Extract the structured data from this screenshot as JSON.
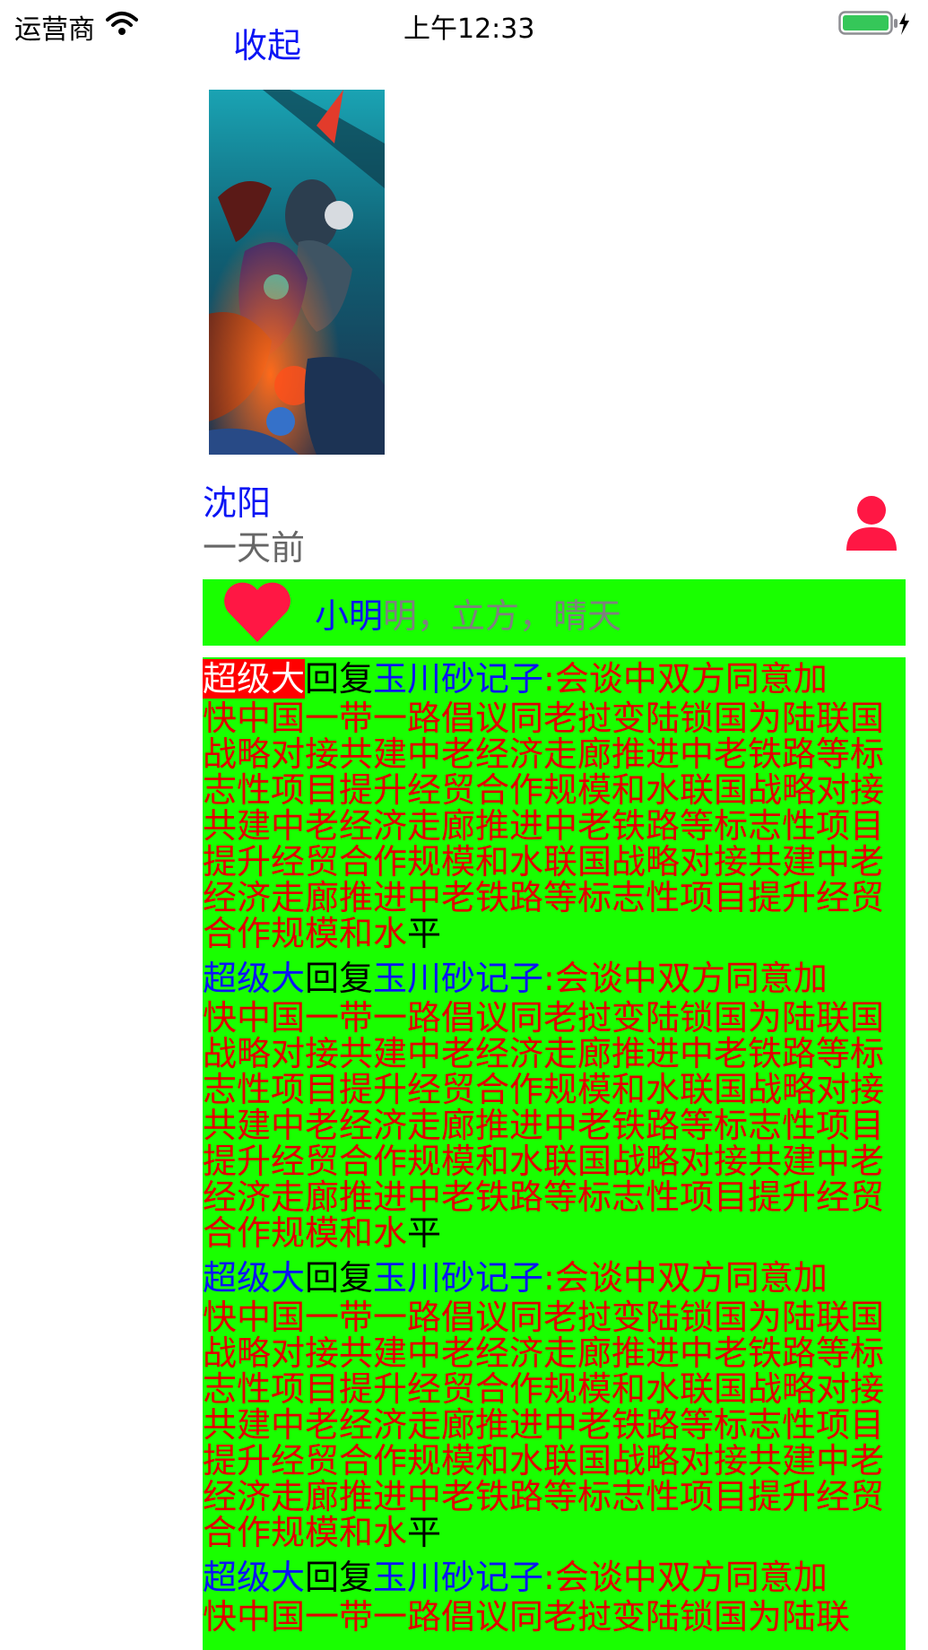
{
  "status_bar": {
    "carrier": "运营商",
    "time": "上午12:33",
    "wifi_icon": "wifi-icon",
    "battery_icon": "battery-charging-icon",
    "battery_color": "#35c759"
  },
  "header": {
    "collapse_label": "收起"
  },
  "post": {
    "image": "fantasy-game-artwork",
    "username": "沈阳",
    "time": "一天前",
    "avatar_icon": "user-icon",
    "avatar_color": "#ff1744"
  },
  "likes": {
    "heart_icon": "heart-icon",
    "first": "小明",
    "rest": "明，立方，晴天",
    "bar_color": "#19ff00"
  },
  "comments": [
    {
      "from": "超级大",
      "reply": "回复",
      "to": "玉川砂记子",
      "lead": ":会谈中双方同意加",
      "body": "快中国一带一路倡议同老挝变陆锁国为陆联国战略对接共建中老经济走廊推进中老铁路等标志性项目提升经贸合作规模和水联国战略对接共建中老经济走廊推进中老铁路等标志性项目提升经贸合作规模和水联国战略对接共建中老经济走廊推进中老铁路等标志性项目提升经贸合作规模和水",
      "tail": "平"
    },
    {
      "from": "超级大",
      "reply": "回复",
      "to": "玉川砂记子",
      "lead": ":会谈中双方同意加",
      "body": "快中国一带一路倡议同老挝变陆锁国为陆联国战略对接共建中老经济走廊推进中老铁路等标志性项目提升经贸合作规模和水联国战略对接共建中老经济走廊推进中老铁路等标志性项目提升经贸合作规模和水联国战略对接共建中老经济走廊推进中老铁路等标志性项目提升经贸合作规模和水",
      "tail": "平"
    },
    {
      "from": "超级大",
      "reply": "回复",
      "to": "玉川砂记子",
      "lead": ":会谈中双方同意加",
      "body": "快中国一带一路倡议同老挝变陆锁国为陆联国战略对接共建中老经济走廊推进中老铁路等标志性项目提升经贸合作规模和水联国战略对接共建中老经济走廊推进中老铁路等标志性项目提升经贸合作规模和水联国战略对接共建中老经济走廊推进中老铁路等标志性项目提升经贸合作规模和水",
      "tail": "平"
    },
    {
      "from": "超级大",
      "reply": "回复",
      "to": "玉川砂记子",
      "lead": ":会谈中双方同意加",
      "body": "快中国一带一路倡议同老挝变陆锁国为陆联",
      "tail": ""
    }
  ]
}
